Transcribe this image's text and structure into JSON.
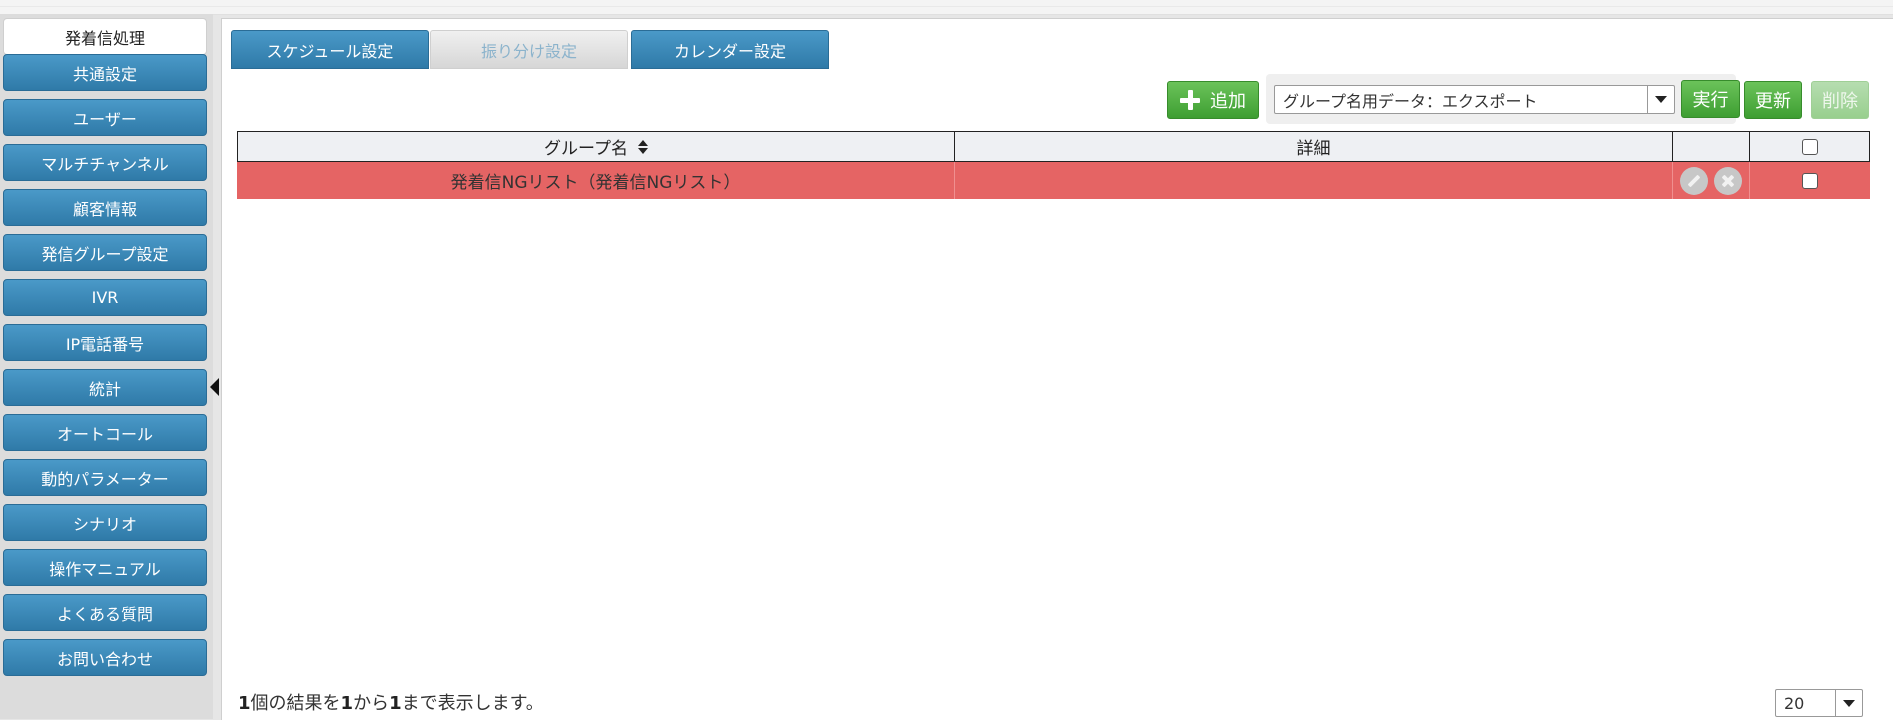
{
  "sidebar": {
    "items": [
      {
        "label": "発着信処理",
        "active": true
      },
      {
        "label": "共通設定"
      },
      {
        "label": "ユーザー"
      },
      {
        "label": "マルチチャンネル"
      },
      {
        "label": "顧客情報"
      },
      {
        "label": "発信グループ設定"
      },
      {
        "label": "IVR"
      },
      {
        "label": "IP電話番号"
      },
      {
        "label": "統計"
      },
      {
        "label": "オートコール"
      },
      {
        "label": "動的パラメーター"
      },
      {
        "label": "シナリオ"
      },
      {
        "label": "操作マニュアル"
      },
      {
        "label": "よくある質問"
      },
      {
        "label": "お問い合わせ"
      }
    ]
  },
  "tabs": [
    {
      "label": "スケジュール設定",
      "active": false
    },
    {
      "label": "振り分け設定",
      "active": true
    },
    {
      "label": "カレンダー設定",
      "active": false
    }
  ],
  "toolbar": {
    "add_label": "追加",
    "export_select_value": "グループ名用データ：エクスポート",
    "run_label": "実行",
    "refresh_label": "更新",
    "delete_label": "削除"
  },
  "table": {
    "columns": [
      "グループ名",
      "詳細"
    ],
    "rows": [
      {
        "group_name": "発着信NGリスト（発着信NGリスト）",
        "detail": ""
      }
    ]
  },
  "footer": {
    "count": "1",
    "text_1": "個の結果を",
    "from": "1",
    "text_2": "から",
    "to": "1",
    "text_3": "まで表示します。",
    "per_page": "20"
  },
  "colors": {
    "accent_blue": "#3a88b8",
    "action_green": "#4caf3c",
    "highlight_row": "#e56464"
  }
}
